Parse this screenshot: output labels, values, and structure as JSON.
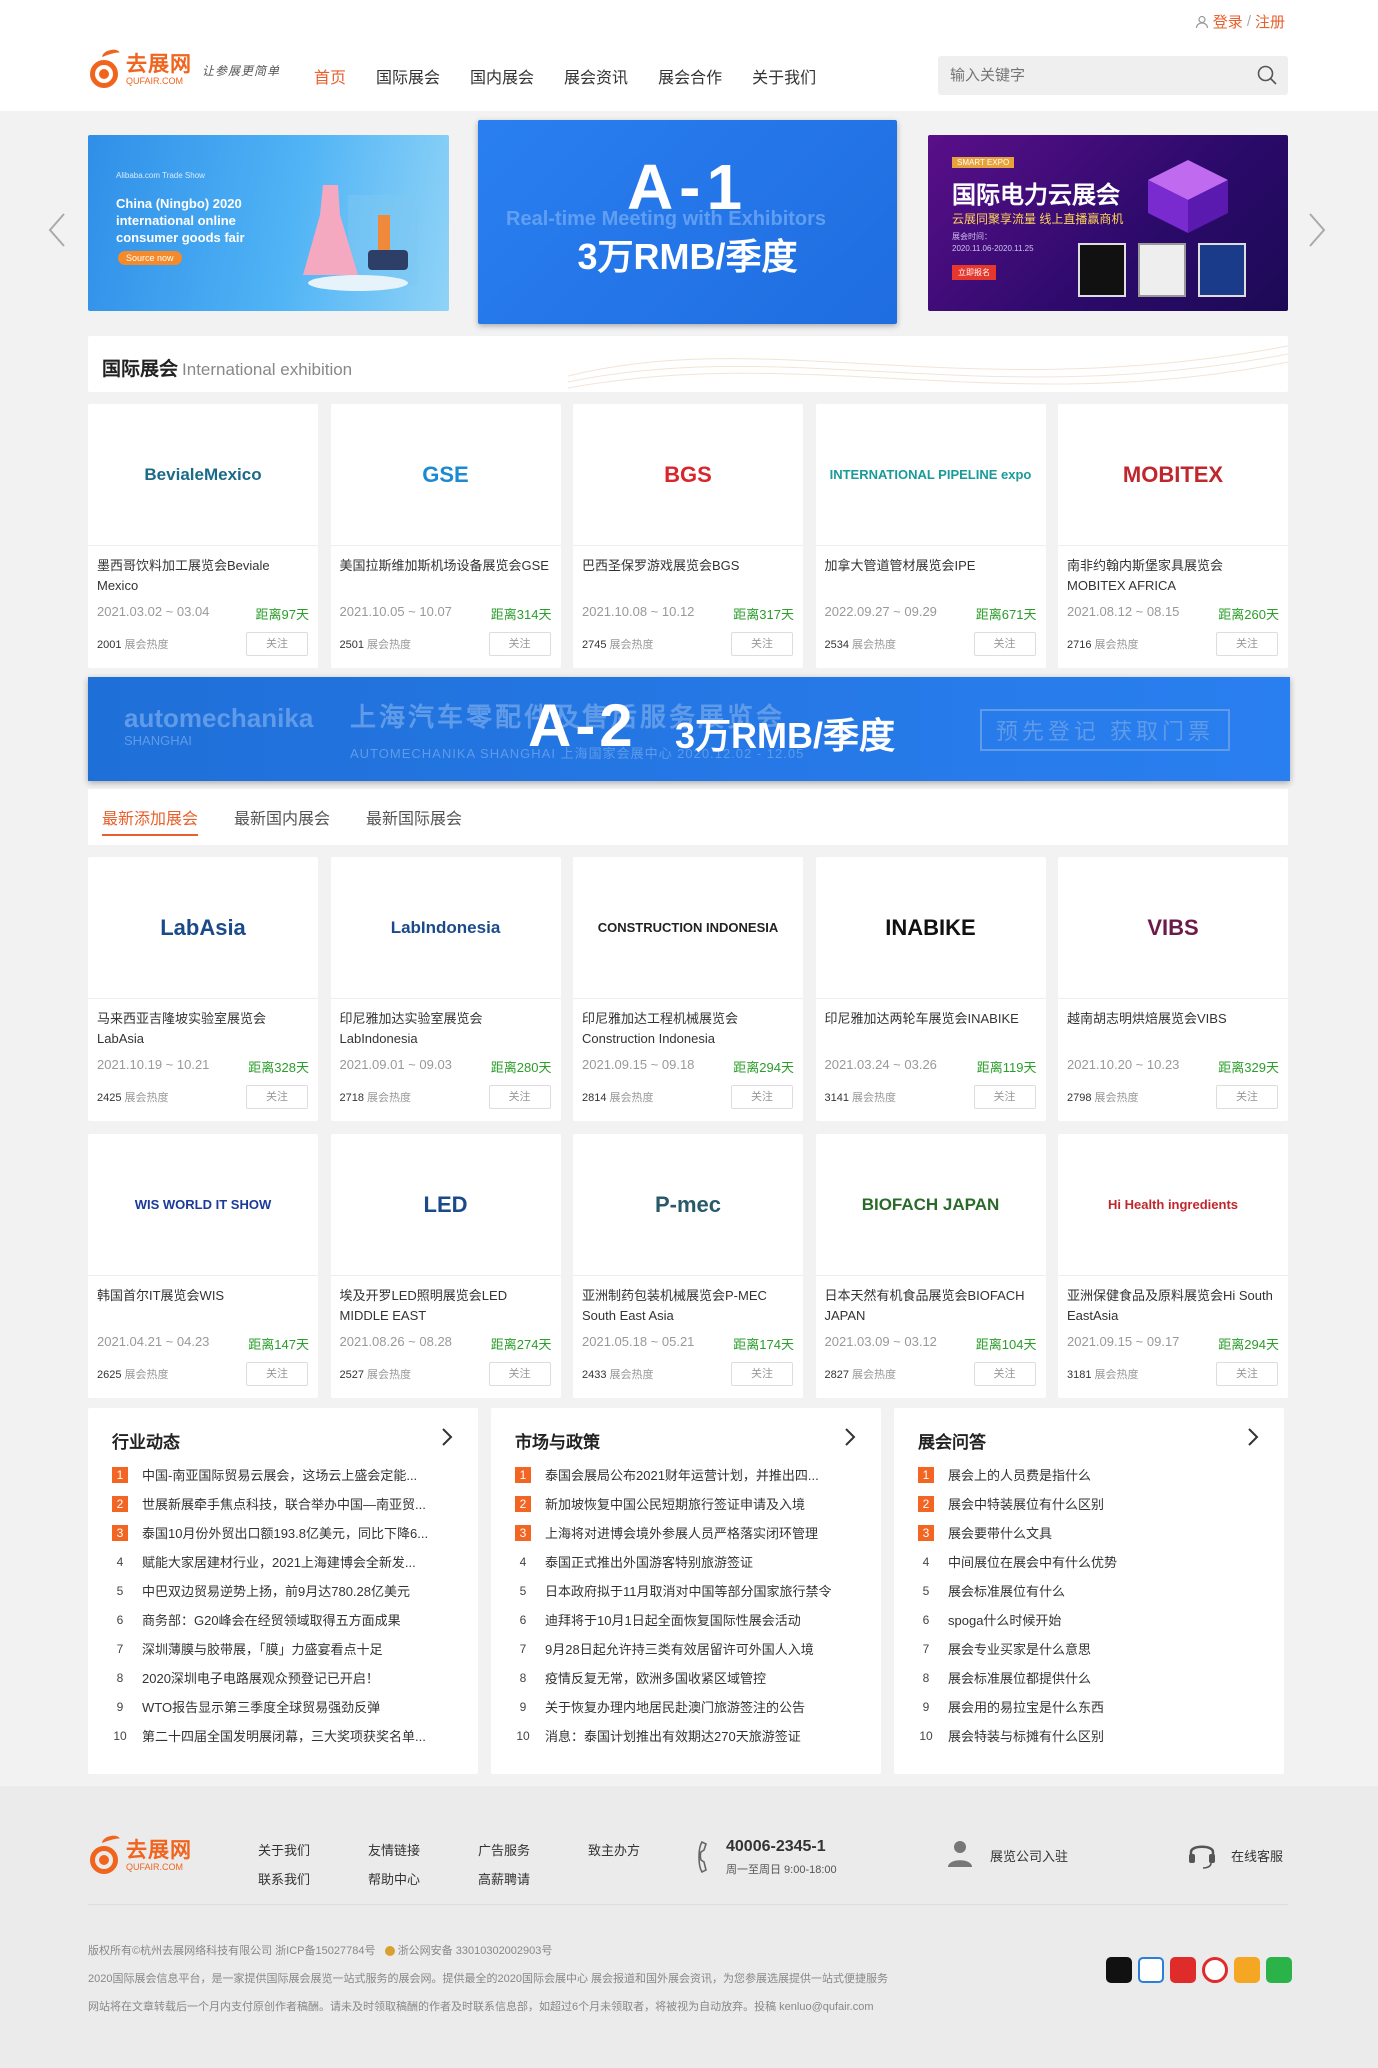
{
  "header": {
    "login": "登录",
    "register": "注册",
    "logo_cn": "去展网",
    "logo_en": "QUFAIR.COM",
    "slogan": "让参展更简单",
    "nav": [
      "首页",
      "国际展会",
      "国内展会",
      "展会资讯",
      "展会合作",
      "关于我们"
    ],
    "search_placeholder": "输入关键字"
  },
  "banners": {
    "left": {
      "brand": "Alibaba.com Trade Show",
      "title": "China (Ningbo) 2020 international online consumer goods fair",
      "button": "Source now"
    },
    "center": {
      "ghost": "Real-time Meeting with Exhibitors",
      "code": "A-1",
      "price": "3万RMB/季度"
    },
    "right": {
      "tag": "SMART EXPO",
      "title": "国际电力云展会",
      "subtitle": "云展同聚享流量 线上直播赢商机",
      "date_label": "展会时间：",
      "date": "2020.11.06-2020.11.25",
      "button": "立即报名"
    }
  },
  "intl": {
    "title": "国际展会",
    "subtitle": "International exhibition",
    "cards": [
      {
        "logo": "BevialeMexico",
        "name": "墨西哥饮料加工展览会Beviale Mexico",
        "date": "2021.03.02 ~ 03.04",
        "dist": "距离97天",
        "heat": "2001",
        "heat_label": "展会热度",
        "follow": "关注",
        "color": "#1b6a8a"
      },
      {
        "logo": "GSE",
        "name": "美国拉斯维加斯机场设备展览会GSE",
        "date": "2021.10.05 ~ 10.07",
        "dist": "距离314天",
        "heat": "2501",
        "heat_label": "展会热度",
        "follow": "关注",
        "color": "#1b8ad0"
      },
      {
        "logo": "BGS",
        "name": "巴西圣保罗游戏展览会BGS",
        "date": "2021.10.08 ~ 10.12",
        "dist": "距离317天",
        "heat": "2745",
        "heat_label": "展会热度",
        "follow": "关注",
        "color": "#d8262c"
      },
      {
        "logo": "INTERNATIONAL PIPELINE expo",
        "name": "加拿大管道管材展览会IPE",
        "date": "2022.09.27 ~ 09.29",
        "dist": "距离671天",
        "heat": "2534",
        "heat_label": "展会热度",
        "follow": "关注",
        "color": "#1b9a9a"
      },
      {
        "logo": "MOBITEX",
        "name": "南非约翰内斯堡家具展览会MOBITEX AFRICA",
        "date": "2021.08.12 ~ 08.15",
        "dist": "距离260天",
        "heat": "2716",
        "heat_label": "展会热度",
        "follow": "关注",
        "color": "#c0272d"
      }
    ]
  },
  "ad2": {
    "code": "A-2",
    "price": "3万RMB/季度",
    "ghost1": "automechanika",
    "ghost2": "SHANGHAI",
    "ghost3": "上海汽车零配件及售后服务展览会",
    "ghost4": "AUTOMECHANIKA SHANGHAI  上海国家会展中心  2020.12.02 - 12.05",
    "ghost5": "预先登记 获取门票"
  },
  "tabs": [
    "最新添加展会",
    "最新国内展会",
    "最新国际展会"
  ],
  "latest": {
    "cards": [
      {
        "logo": "LabAsia",
        "name": "马来西亚吉隆坡实验室展览会LabAsia",
        "date": "2021.10.19 ~ 10.21",
        "dist": "距离328天",
        "heat": "2425",
        "heat_label": "展会热度",
        "follow": "关注",
        "color": "#1b4a8a"
      },
      {
        "logo": "LabIndonesia",
        "name": "印尼雅加达实验室展览会LabIndonesia",
        "date": "2021.09.01 ~ 09.03",
        "dist": "距离280天",
        "heat": "2718",
        "heat_label": "展会热度",
        "follow": "关注",
        "color": "#1b4a8a"
      },
      {
        "logo": "CONSTRUCTION INDONESIA",
        "name": "印尼雅加达工程机械展览会Construction Indonesia",
        "date": "2021.09.15 ~ 09.18",
        "dist": "距离294天",
        "heat": "2814",
        "heat_label": "展会热度",
        "follow": "关注",
        "color": "#222222"
      },
      {
        "logo": "INABIKE",
        "name": "印尼雅加达两轮车展览会INABIKE",
        "date": "2021.03.24 ~ 03.26",
        "dist": "距离119天",
        "heat": "3141",
        "heat_label": "展会热度",
        "follow": "关注",
        "color": "#111111"
      },
      {
        "logo": "VIBS",
        "name": "越南胡志明烘焙展览会VIBS",
        "date": "2021.10.20 ~ 10.23",
        "dist": "距离329天",
        "heat": "2798",
        "heat_label": "展会热度",
        "follow": "关注",
        "color": "#6a1b4a"
      },
      {
        "logo": "WIS WORLD IT SHOW",
        "name": "韩国首尔IT展览会WIS",
        "date": "2021.04.21 ~ 04.23",
        "dist": "距离147天",
        "heat": "2625",
        "heat_label": "展会热度",
        "follow": "关注",
        "color": "#1b3a9a"
      },
      {
        "logo": "LED",
        "name": "埃及开罗LED照明展览会LED MIDDLE EAST",
        "date": "2021.08.26 ~ 08.28",
        "dist": "距离274天",
        "heat": "2527",
        "heat_label": "展会热度",
        "follow": "关注",
        "color": "#1b4a8a"
      },
      {
        "logo": "P-mec",
        "name": "亚洲制药包装机械展览会P-MEC South East Asia",
        "date": "2021.05.18 ~ 05.21",
        "dist": "距离174天",
        "heat": "2433",
        "heat_label": "展会热度",
        "follow": "关注",
        "color": "#2a5a6a"
      },
      {
        "logo": "BIOFACH JAPAN",
        "name": "日本天然有机食品展览会BIOFACH JAPAN",
        "date": "2021.03.09 ~ 03.12",
        "dist": "距离104天",
        "heat": "2827",
        "heat_label": "展会热度",
        "follow": "关注",
        "color": "#2a6a2a"
      },
      {
        "logo": "Hi Health ingredients",
        "name": "亚洲保健食品及原料展览会Hi South EastAsia",
        "date": "2021.09.15 ~ 09.17",
        "dist": "距离294天",
        "heat": "3181",
        "heat_label": "展会热度",
        "follow": "关注",
        "color": "#c0272d"
      }
    ]
  },
  "news": [
    {
      "title": "行业动态",
      "items": [
        "中国-南亚国际贸易云展会，这场云上盛会定能...",
        "世展新展牵手焦点科技，联合举办中国—南亚贸...",
        "泰国10月份外贸出口额193.8亿美元，同比下降6...",
        "赋能大家居建材行业，2021上海建博会全新发...",
        "中巴双边贸易逆势上扬，前9月达780.28亿美元",
        "商务部：G20峰会在经贸领域取得五方面成果",
        "深圳薄膜与胶带展，「膜」力盛宴看点十足",
        "2020深圳电子电路展观众预登记已开启！",
        "WTO报告显示第三季度全球贸易强劲反弹",
        "第二十四届全国发明展闭幕，三大奖项获奖名单..."
      ]
    },
    {
      "title": "市场与政策",
      "items": [
        "泰国会展局公布2021财年运营计划，并推出四...",
        "新加坡恢复中国公民短期旅行签证申请及入境",
        "上海将对进博会境外参展人员严格落实闭环管理",
        "泰国正式推出外国游客特别旅游签证",
        "日本政府拟于11月取消对中国等部分国家旅行禁令",
        "迪拜将于10月1日起全面恢复国际性展会活动",
        "9月28日起允许持三类有效居留许可外国人入境",
        "疫情反复无常，欧洲多国收紧区域管控",
        "关于恢复办理内地居民赴澳门旅游签注的公告",
        "消息：泰国计划推出有效期达270天旅游签证"
      ]
    },
    {
      "title": "展会问答",
      "items": [
        "展会上的人员费是指什么",
        "展会中特装展位有什么区别",
        "展会要带什么文具",
        "中间展位在展会中有什么优势",
        "展会标准展位有什么",
        "spoga什么时候开始",
        "展会专业买家是什么意思",
        "展会标准展位都提供什么",
        "展会用的易拉宝是什么东西",
        "展会特装与标摊有什么区别"
      ]
    }
  ],
  "footer": {
    "links": [
      "关于我们",
      "联系我们",
      "友情链接",
      "帮助中心",
      "广告服务",
      "高薪聘请",
      "致主办方"
    ],
    "phone": "40006-2345-1",
    "hours": "周一至周日 9:00-18:00",
    "join": "展览公司入驻",
    "service": "在线客服",
    "copyright": "版权所有©杭州去展网络科技有限公司  浙ICP备15027784号",
    "police": "浙公网安备 33010302002903号",
    "desc": "2020国际展会信息平台，是一家提供国际展会展览一站式服务的展会网。提供最全的2020国际会展中心 展会报道和国外展会资讯，为您参展选展提供一站式便捷服务",
    "notice": "网站将在文章转载后一个月内支付原创作者稿酬。请未及时领取稿酬的作者及时联系信息部，如超过6个月未领取者，将被视为自动放弃。投稿 kenluo@qufair.com"
  }
}
